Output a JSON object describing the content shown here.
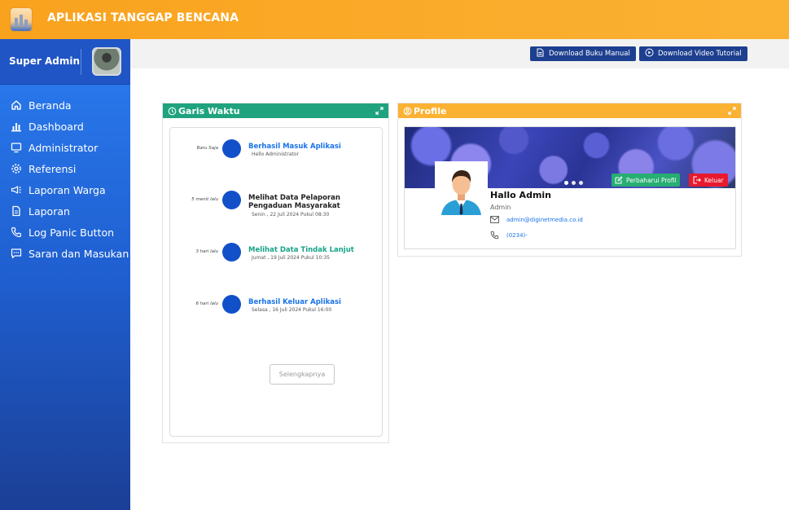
{
  "app": {
    "title": "APLIKASI TANGGAP BENCANA"
  },
  "sidebar": {
    "user": "Super Admin",
    "items": [
      {
        "label": "Beranda",
        "icon": "home-icon"
      },
      {
        "label": "Dashboard",
        "icon": "bar-chart-icon"
      },
      {
        "label": "Administrator",
        "icon": "monitor-icon"
      },
      {
        "label": "Referensi",
        "icon": "gear-icon"
      },
      {
        "label": "Laporan Warga",
        "icon": "megaphone-icon"
      },
      {
        "label": "Laporan",
        "icon": "document-icon"
      },
      {
        "label": "Log Panic Button",
        "icon": "phone-icon"
      },
      {
        "label": "Saran dan Masukan",
        "icon": "chat-icon"
      }
    ]
  },
  "toolbar": {
    "download_manual": "Download Buku Manual",
    "download_video": "Download Video Tutorial"
  },
  "timeline": {
    "title": "Garis Waktu",
    "items": [
      {
        "time": "Baru Saja",
        "title": "Berhasil Masuk Aplikasi",
        "subtitle": "Hello Administrator"
      },
      {
        "time": "5 menit lalu",
        "title": "Melihat Data Pelaporan Pengaduan Masyarakat",
        "subtitle": "Senin , 22 Juli 2024 Pukul 08:30"
      },
      {
        "time": "3 hari lalu",
        "title": "Melihat Data Tindak Lanjut",
        "subtitle": "Jumat , 19 Juli 2024 Pukul 10:35"
      },
      {
        "time": "6 hari lalu",
        "title": "Berhasil Keluar Aplikasi",
        "subtitle": "Selasa , 16 Juli 2024 Pukul 16:00"
      }
    ],
    "more_label": "Selengkapnya"
  },
  "profile": {
    "title": "Profile",
    "update_label": "Perbaharui Profil",
    "logout_label": "Keluar",
    "greeting": "Hallo Admin",
    "role": "Admin",
    "email": "admin@diginetmedia.co.id",
    "phone": "(0234)-"
  },
  "colors": {
    "topbar": "#f9a21e",
    "sidebar": "#1f5fd0",
    "timeline_header": "#1fa37e",
    "profile_header": "#fbb233",
    "primary_dark": "#1d3f8f",
    "link_blue": "#1a73e8",
    "teal": "#17a389"
  }
}
